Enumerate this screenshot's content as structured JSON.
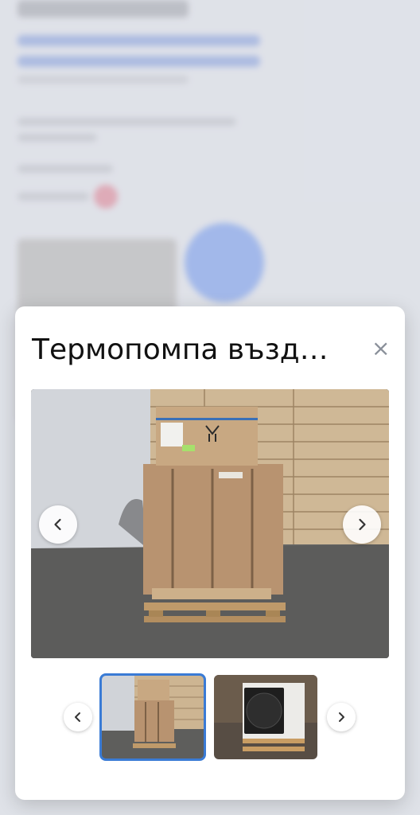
{
  "modal": {
    "title": "Термопомпа възд…",
    "close_symbol": "×",
    "prev_label": "Previous image",
    "next_label": "Next image",
    "thumbnails": [
      {
        "label": "Boxed heat pump on pallet",
        "selected": true
      },
      {
        "label": "Unboxed heat pump unit on pallet",
        "selected": false
      }
    ]
  },
  "colors": {
    "accent": "#3a7bd5",
    "close": "#8a909a",
    "title": "#111111"
  },
  "icons": {
    "close": "close-icon",
    "prev": "chevron-left-icon",
    "next": "chevron-right-icon"
  }
}
